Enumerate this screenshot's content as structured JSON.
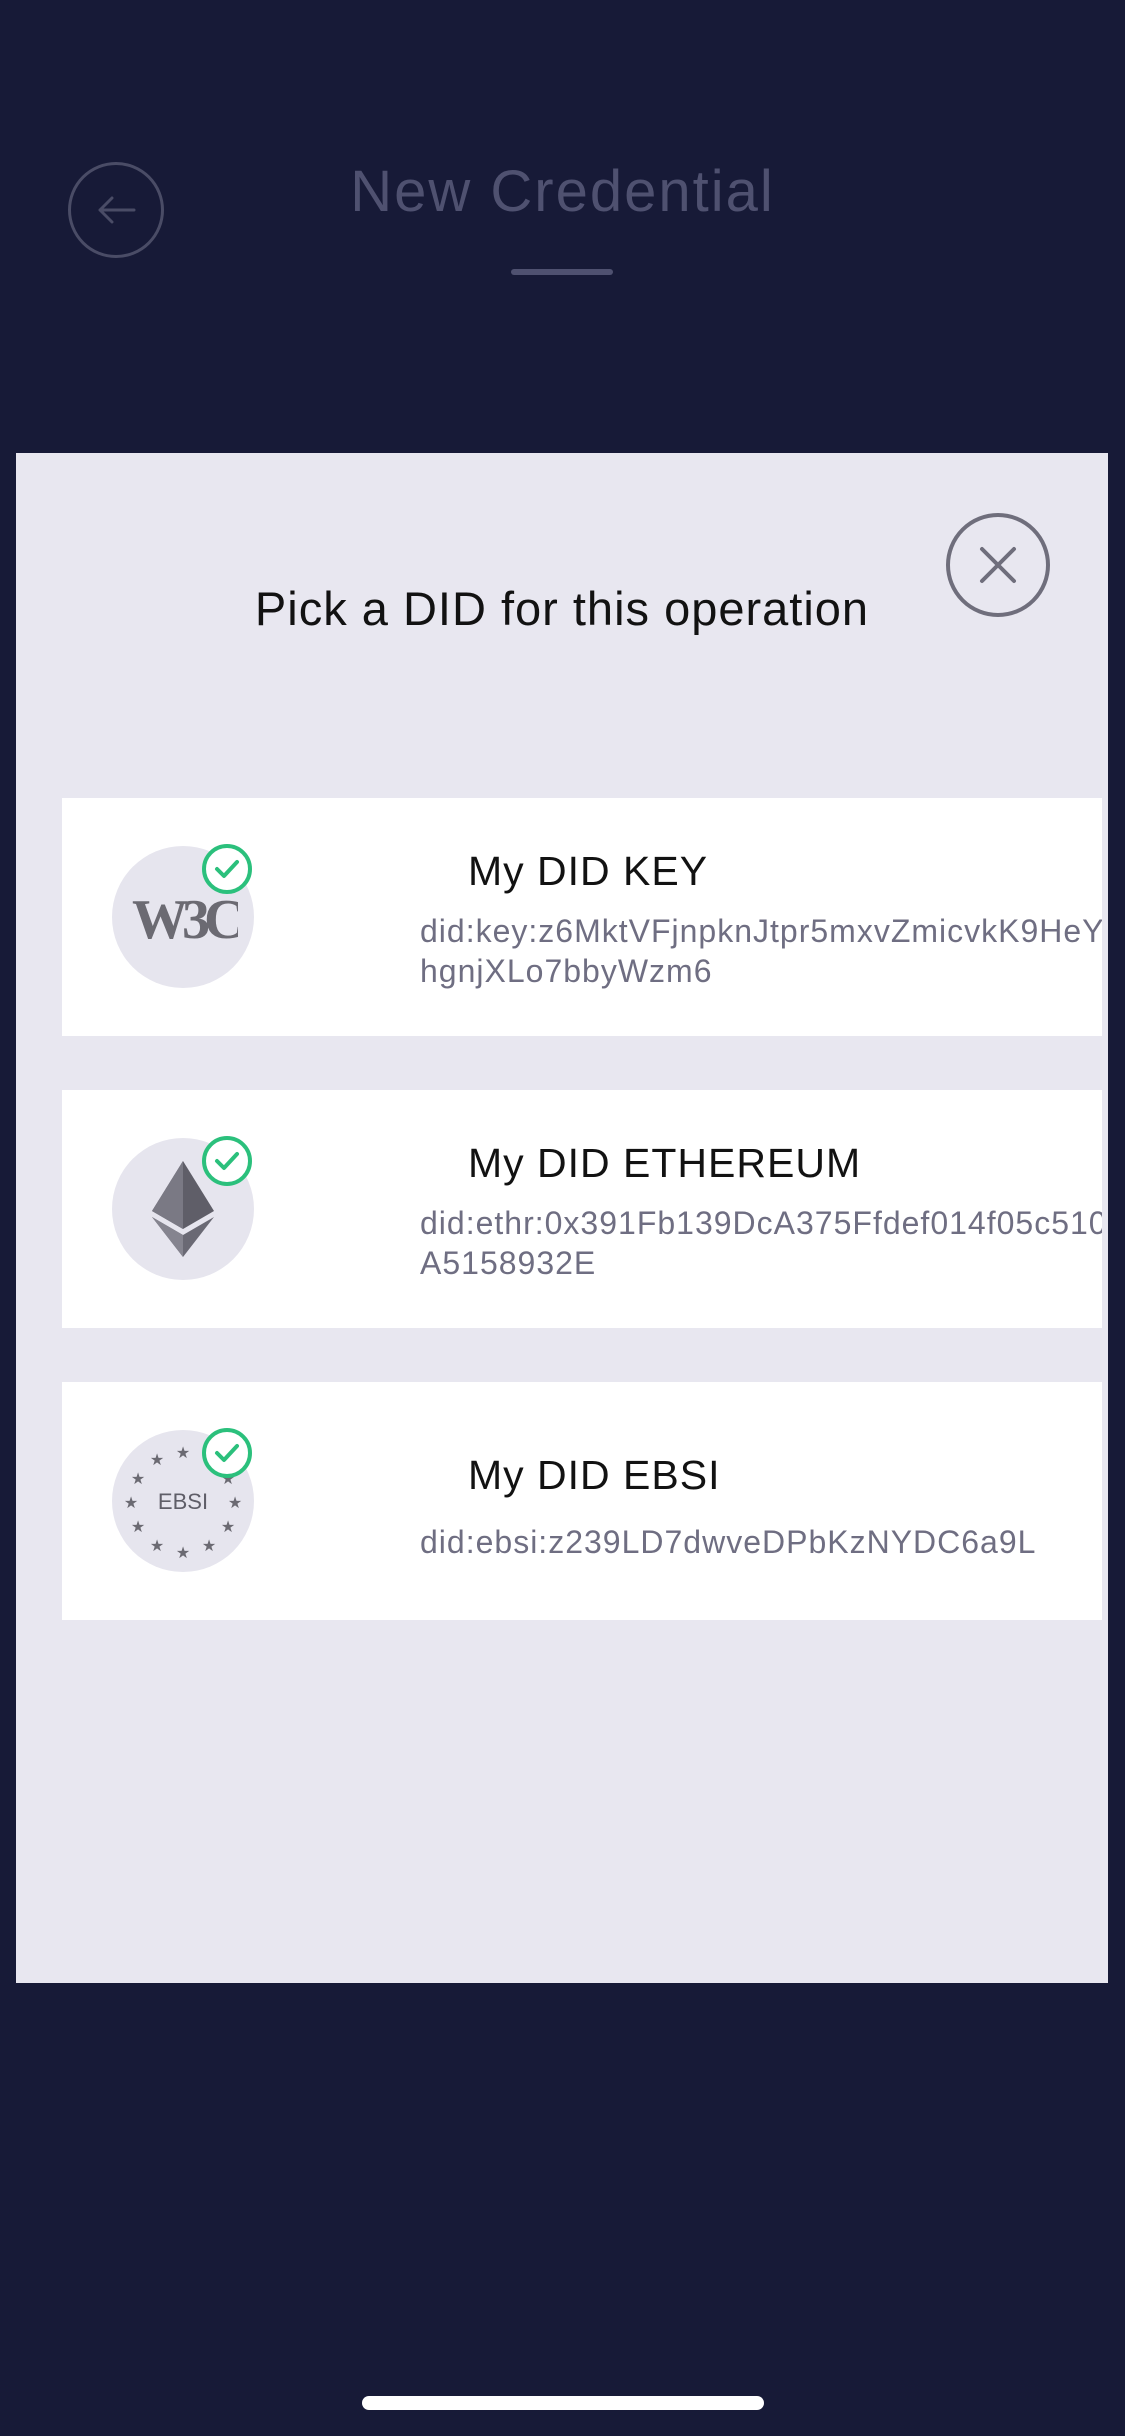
{
  "header": {
    "title": "New Credential"
  },
  "modal": {
    "title": "Pick a DID for this operation",
    "dids": [
      {
        "name": "My DID KEY",
        "value": "did:key:z6MktVFjnpknJtpr5mxvZmicvkK9HeYhgnjXLo7bbyWzm6",
        "logo": "w3c-logo",
        "selected": true
      },
      {
        "name": "My DID ETHEREUM",
        "value": "did:ethr:0x391Fb139DcA375Ffdef014f05c510A5158932E",
        "logo": "ethereum-logo",
        "selected": true
      },
      {
        "name": "My DID EBSI",
        "value": "did:ebsi:z239LD7dwveDPbKzNYDC6a9L",
        "logo": "ebsi-logo",
        "selected": true
      }
    ]
  },
  "colors": {
    "background": "#171a37",
    "sheet": "#e8e7f0",
    "check": "#2bc07c"
  }
}
